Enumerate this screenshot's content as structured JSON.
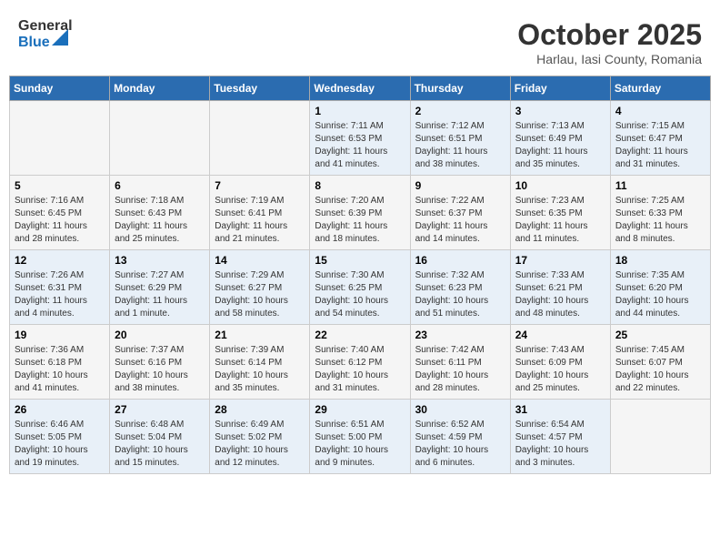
{
  "header": {
    "logo_general": "General",
    "logo_blue": "Blue",
    "month_title": "October 2025",
    "subtitle": "Harlau, Iasi County, Romania"
  },
  "days_of_week": [
    "Sunday",
    "Monday",
    "Tuesday",
    "Wednesday",
    "Thursday",
    "Friday",
    "Saturday"
  ],
  "weeks": [
    {
      "even": true,
      "days": [
        {
          "number": "",
          "info": ""
        },
        {
          "number": "",
          "info": ""
        },
        {
          "number": "",
          "info": ""
        },
        {
          "number": "1",
          "info": "Sunrise: 7:11 AM\nSunset: 6:53 PM\nDaylight: 11 hours and 41 minutes."
        },
        {
          "number": "2",
          "info": "Sunrise: 7:12 AM\nSunset: 6:51 PM\nDaylight: 11 hours and 38 minutes."
        },
        {
          "number": "3",
          "info": "Sunrise: 7:13 AM\nSunset: 6:49 PM\nDaylight: 11 hours and 35 minutes."
        },
        {
          "number": "4",
          "info": "Sunrise: 7:15 AM\nSunset: 6:47 PM\nDaylight: 11 hours and 31 minutes."
        }
      ]
    },
    {
      "even": false,
      "days": [
        {
          "number": "5",
          "info": "Sunrise: 7:16 AM\nSunset: 6:45 PM\nDaylight: 11 hours and 28 minutes."
        },
        {
          "number": "6",
          "info": "Sunrise: 7:18 AM\nSunset: 6:43 PM\nDaylight: 11 hours and 25 minutes."
        },
        {
          "number": "7",
          "info": "Sunrise: 7:19 AM\nSunset: 6:41 PM\nDaylight: 11 hours and 21 minutes."
        },
        {
          "number": "8",
          "info": "Sunrise: 7:20 AM\nSunset: 6:39 PM\nDaylight: 11 hours and 18 minutes."
        },
        {
          "number": "9",
          "info": "Sunrise: 7:22 AM\nSunset: 6:37 PM\nDaylight: 11 hours and 14 minutes."
        },
        {
          "number": "10",
          "info": "Sunrise: 7:23 AM\nSunset: 6:35 PM\nDaylight: 11 hours and 11 minutes."
        },
        {
          "number": "11",
          "info": "Sunrise: 7:25 AM\nSunset: 6:33 PM\nDaylight: 11 hours and 8 minutes."
        }
      ]
    },
    {
      "even": true,
      "days": [
        {
          "number": "12",
          "info": "Sunrise: 7:26 AM\nSunset: 6:31 PM\nDaylight: 11 hours and 4 minutes."
        },
        {
          "number": "13",
          "info": "Sunrise: 7:27 AM\nSunset: 6:29 PM\nDaylight: 11 hours and 1 minute."
        },
        {
          "number": "14",
          "info": "Sunrise: 7:29 AM\nSunset: 6:27 PM\nDaylight: 10 hours and 58 minutes."
        },
        {
          "number": "15",
          "info": "Sunrise: 7:30 AM\nSunset: 6:25 PM\nDaylight: 10 hours and 54 minutes."
        },
        {
          "number": "16",
          "info": "Sunrise: 7:32 AM\nSunset: 6:23 PM\nDaylight: 10 hours and 51 minutes."
        },
        {
          "number": "17",
          "info": "Sunrise: 7:33 AM\nSunset: 6:21 PM\nDaylight: 10 hours and 48 minutes."
        },
        {
          "number": "18",
          "info": "Sunrise: 7:35 AM\nSunset: 6:20 PM\nDaylight: 10 hours and 44 minutes."
        }
      ]
    },
    {
      "even": false,
      "days": [
        {
          "number": "19",
          "info": "Sunrise: 7:36 AM\nSunset: 6:18 PM\nDaylight: 10 hours and 41 minutes."
        },
        {
          "number": "20",
          "info": "Sunrise: 7:37 AM\nSunset: 6:16 PM\nDaylight: 10 hours and 38 minutes."
        },
        {
          "number": "21",
          "info": "Sunrise: 7:39 AM\nSunset: 6:14 PM\nDaylight: 10 hours and 35 minutes."
        },
        {
          "number": "22",
          "info": "Sunrise: 7:40 AM\nSunset: 6:12 PM\nDaylight: 10 hours and 31 minutes."
        },
        {
          "number": "23",
          "info": "Sunrise: 7:42 AM\nSunset: 6:11 PM\nDaylight: 10 hours and 28 minutes."
        },
        {
          "number": "24",
          "info": "Sunrise: 7:43 AM\nSunset: 6:09 PM\nDaylight: 10 hours and 25 minutes."
        },
        {
          "number": "25",
          "info": "Sunrise: 7:45 AM\nSunset: 6:07 PM\nDaylight: 10 hours and 22 minutes."
        }
      ]
    },
    {
      "even": true,
      "days": [
        {
          "number": "26",
          "info": "Sunrise: 6:46 AM\nSunset: 5:05 PM\nDaylight: 10 hours and 19 minutes."
        },
        {
          "number": "27",
          "info": "Sunrise: 6:48 AM\nSunset: 5:04 PM\nDaylight: 10 hours and 15 minutes."
        },
        {
          "number": "28",
          "info": "Sunrise: 6:49 AM\nSunset: 5:02 PM\nDaylight: 10 hours and 12 minutes."
        },
        {
          "number": "29",
          "info": "Sunrise: 6:51 AM\nSunset: 5:00 PM\nDaylight: 10 hours and 9 minutes."
        },
        {
          "number": "30",
          "info": "Sunrise: 6:52 AM\nSunset: 4:59 PM\nDaylight: 10 hours and 6 minutes."
        },
        {
          "number": "31",
          "info": "Sunrise: 6:54 AM\nSunset: 4:57 PM\nDaylight: 10 hours and 3 minutes."
        },
        {
          "number": "",
          "info": ""
        }
      ]
    }
  ]
}
